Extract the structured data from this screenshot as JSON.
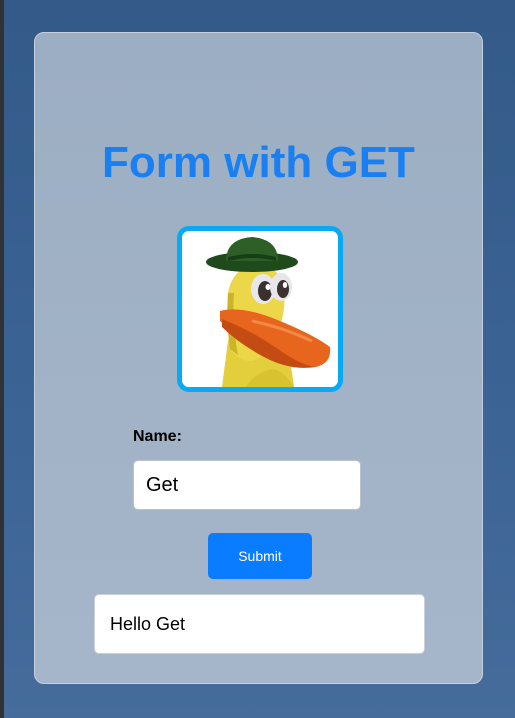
{
  "page": {
    "title": "Form with GET"
  },
  "avatar": {
    "icon": "duck-with-green-hat-icon",
    "border_color": "#08aaf6"
  },
  "form": {
    "name_label": "Name:",
    "name_value": "Get",
    "submit_label": "Submit"
  },
  "result": {
    "message": "Hello Get"
  },
  "colors": {
    "title": "#1a80f2",
    "submit_background": "#0a7cff",
    "page_background": "#3b6394",
    "card_background": "#a2b3c7"
  }
}
